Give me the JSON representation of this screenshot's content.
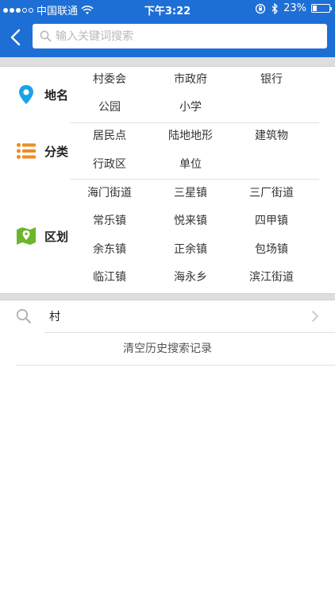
{
  "status_bar": {
    "carrier": "中国联通",
    "time": "下午3:22",
    "battery_percent": "23%",
    "battery_level": 0.23,
    "icons": [
      "signal-dots",
      "wifi-icon",
      "lock-rotation-icon",
      "bluetooth-icon",
      "battery-icon"
    ]
  },
  "navbar": {
    "back_icon": "chevron-left-icon",
    "search_placeholder": "输入关键词搜索",
    "search_value": ""
  },
  "categories": [
    {
      "title": "地名",
      "icon": "map-pin-icon",
      "items": [
        "村委会",
        "市政府",
        "银行",
        "公园",
        "小学"
      ]
    },
    {
      "title": "分类",
      "icon": "list-icon",
      "items": [
        "居民点",
        "陆地地形",
        "建筑物",
        "行政区",
        "单位"
      ]
    },
    {
      "title": "区划",
      "icon": "map-region-icon",
      "items": [
        "海门街道",
        "三星镇",
        "三厂街道",
        "常乐镇",
        "悦来镇",
        "四甲镇",
        "余东镇",
        "正余镇",
        "包场镇",
        "临江镇",
        "海永乡",
        "滨江街道"
      ]
    }
  ],
  "history": {
    "items": [
      {
        "text": "村"
      }
    ],
    "clear_label": "清空历史搜索记录"
  },
  "colors": {
    "primary": "#1d6fd6",
    "pin": "#1aa3e8",
    "list": "#f08c1e",
    "region": "#6cb52d"
  }
}
